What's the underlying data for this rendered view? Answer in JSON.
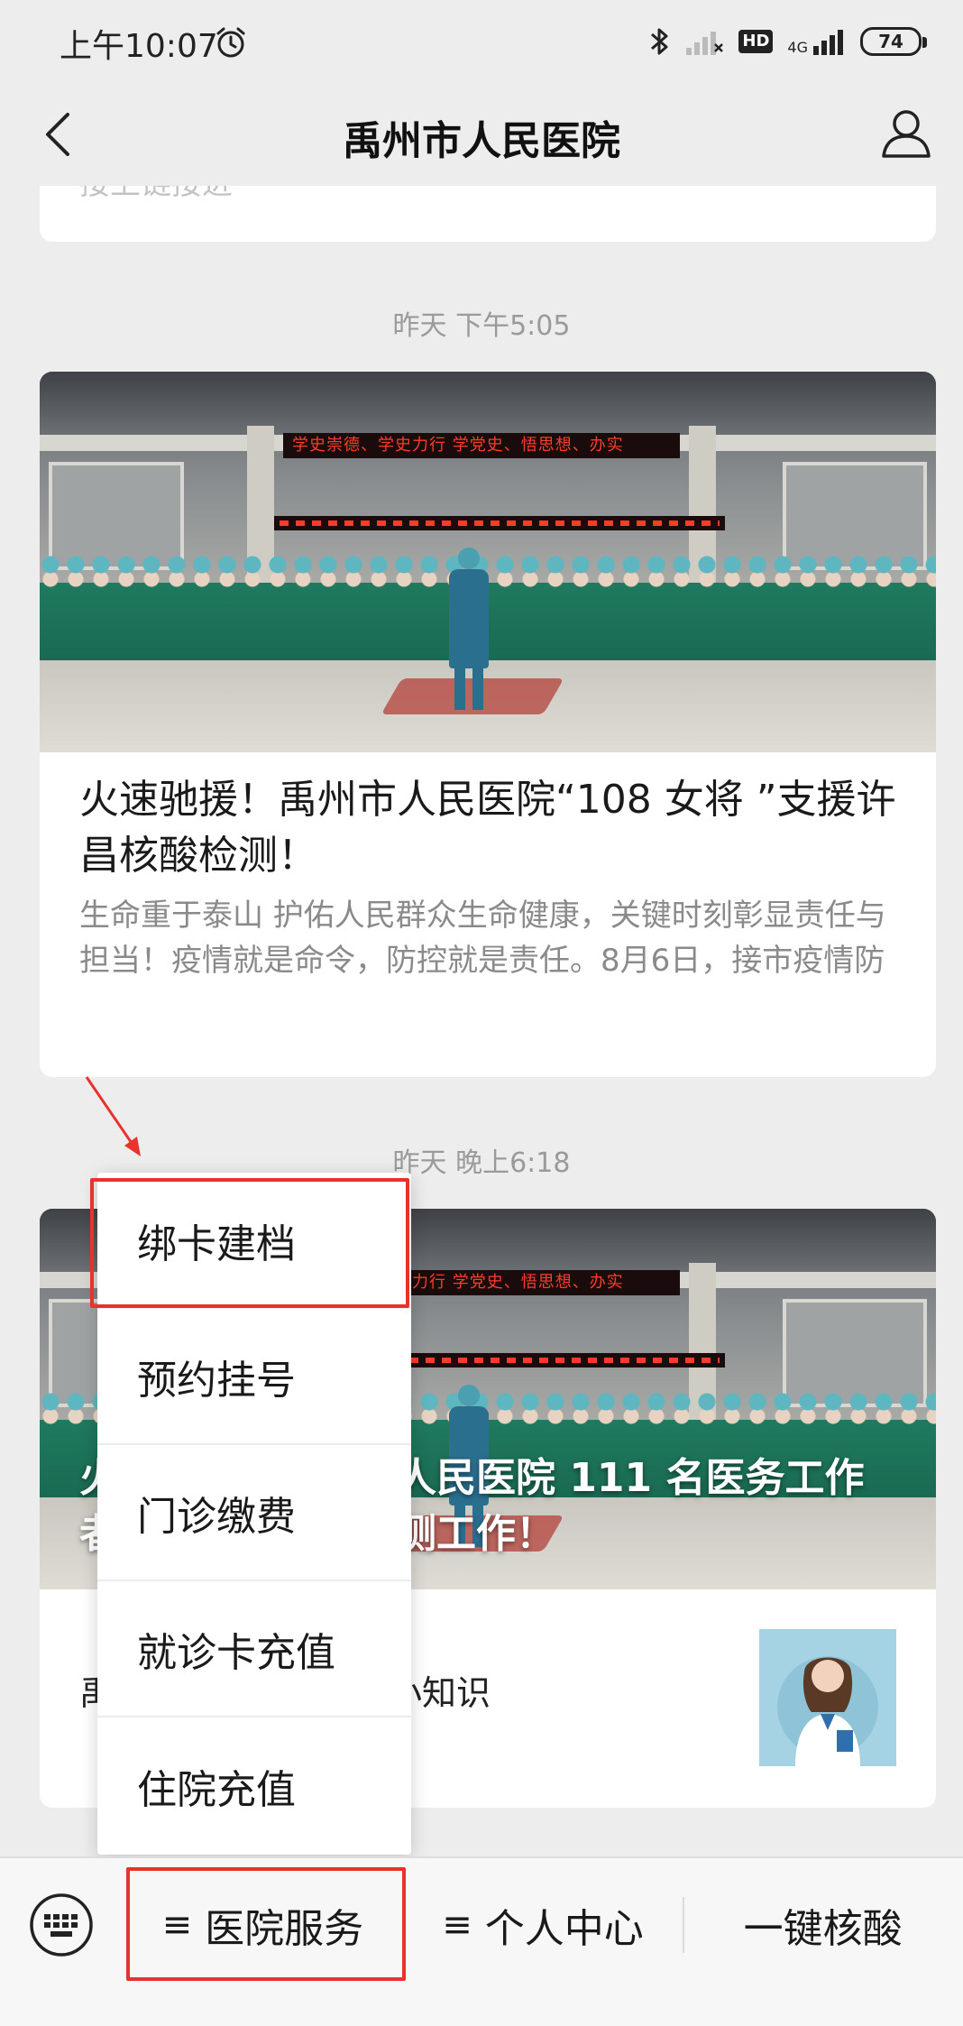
{
  "status_bar": {
    "time": "上午10:07",
    "network_label": "4G",
    "hd_label": "HD",
    "battery": "74"
  },
  "nav": {
    "title": "禹州市人民医院"
  },
  "feed": {
    "partial_card_text": "接上链接进",
    "timestamp_1": "昨天 下午5:05",
    "article_1": {
      "banner_text": "学史崇德、学史力行   学党史、悟思想、办实",
      "title": "火速驰援！禹州市人民医院“108 女将 ”支援许昌核酸检测！",
      "desc": "生命重于泰山 护佑人民群众生命健康，关键时刻彰显责任与担当！疫情就是命令，防控就是责任。8月6日，接市疫情防"
    },
    "timestamp_2": "昨天 晚上6:18",
    "article_2": {
      "banner_text": "学史崇德、学史力行   学党史、悟思想、办实",
      "title": "火速驰援！禹州市人民医院 111 名医务工作者支援许昌核酸检测工作！",
      "sub_item_title": "禹州市人民医院健康小知识"
    }
  },
  "submenu": {
    "items": [
      "绑卡建档",
      "预约挂号",
      "门诊缴费",
      "就诊卡充值",
      "住院充值"
    ]
  },
  "bottom_menu": {
    "keyboard_icon": "keyboard-icon",
    "items": [
      {
        "icon": "≡",
        "label": "医院服务"
      },
      {
        "icon": "≡",
        "label": "个人中心"
      },
      {
        "icon": "",
        "label": "一键核酸"
      }
    ]
  },
  "colors": {
    "highlight": "#e8322c",
    "background": "#ededed"
  }
}
